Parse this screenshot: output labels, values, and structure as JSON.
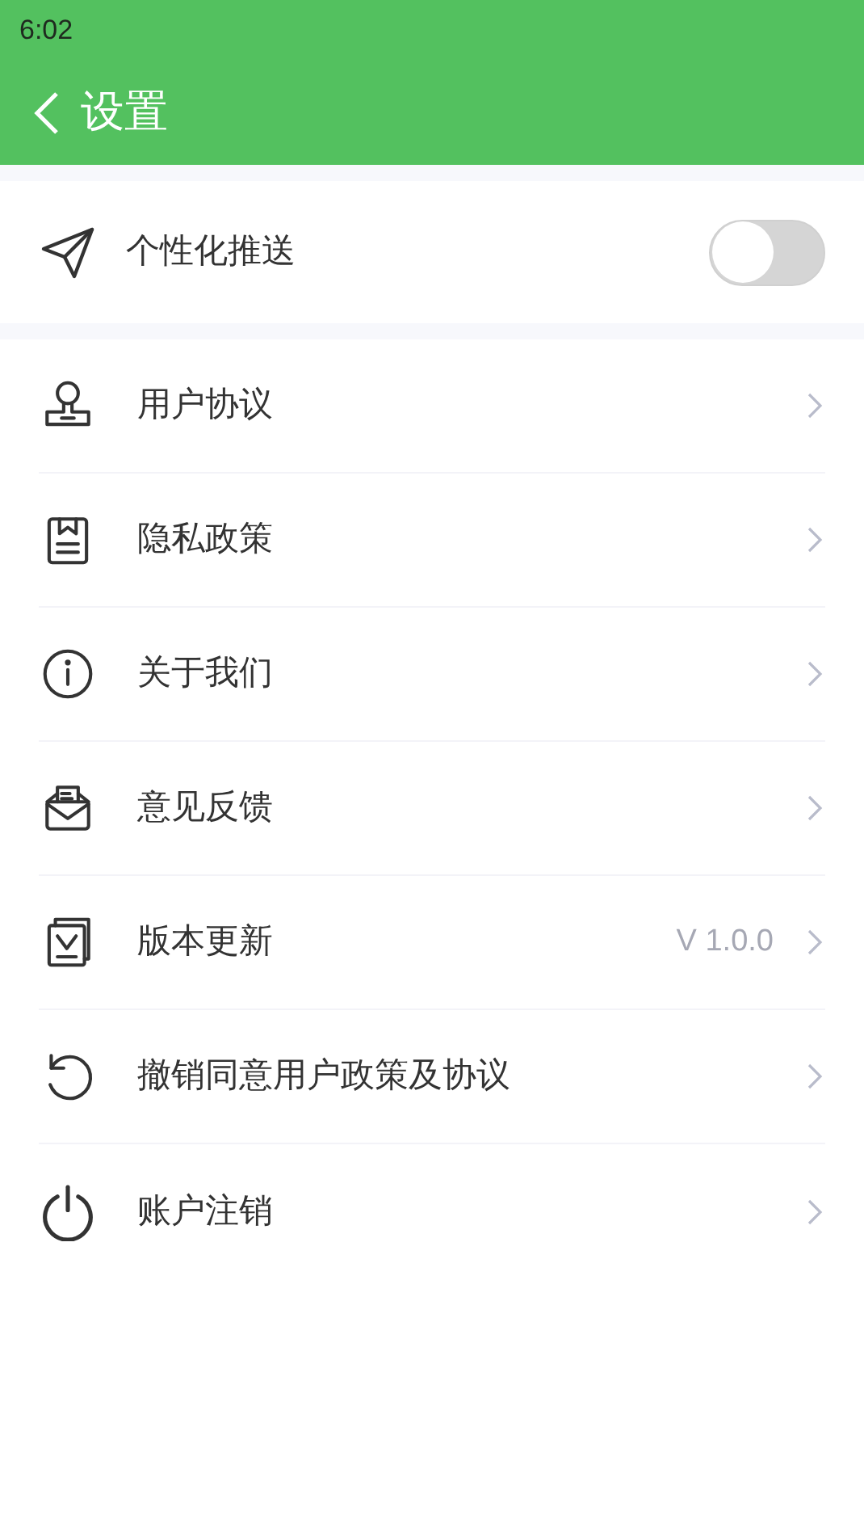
{
  "status_bar": {
    "time": "6:02"
  },
  "header": {
    "title": "设置"
  },
  "push": {
    "label": "个性化推送",
    "on": false
  },
  "items": [
    {
      "label": "用户协议"
    },
    {
      "label": "隐私政策"
    },
    {
      "label": "关于我们"
    },
    {
      "label": "意见反馈"
    },
    {
      "label": "版本更新",
      "value": "V 1.0.0"
    },
    {
      "label": "撤销同意用户政策及协议"
    },
    {
      "label": "账户注销"
    }
  ]
}
